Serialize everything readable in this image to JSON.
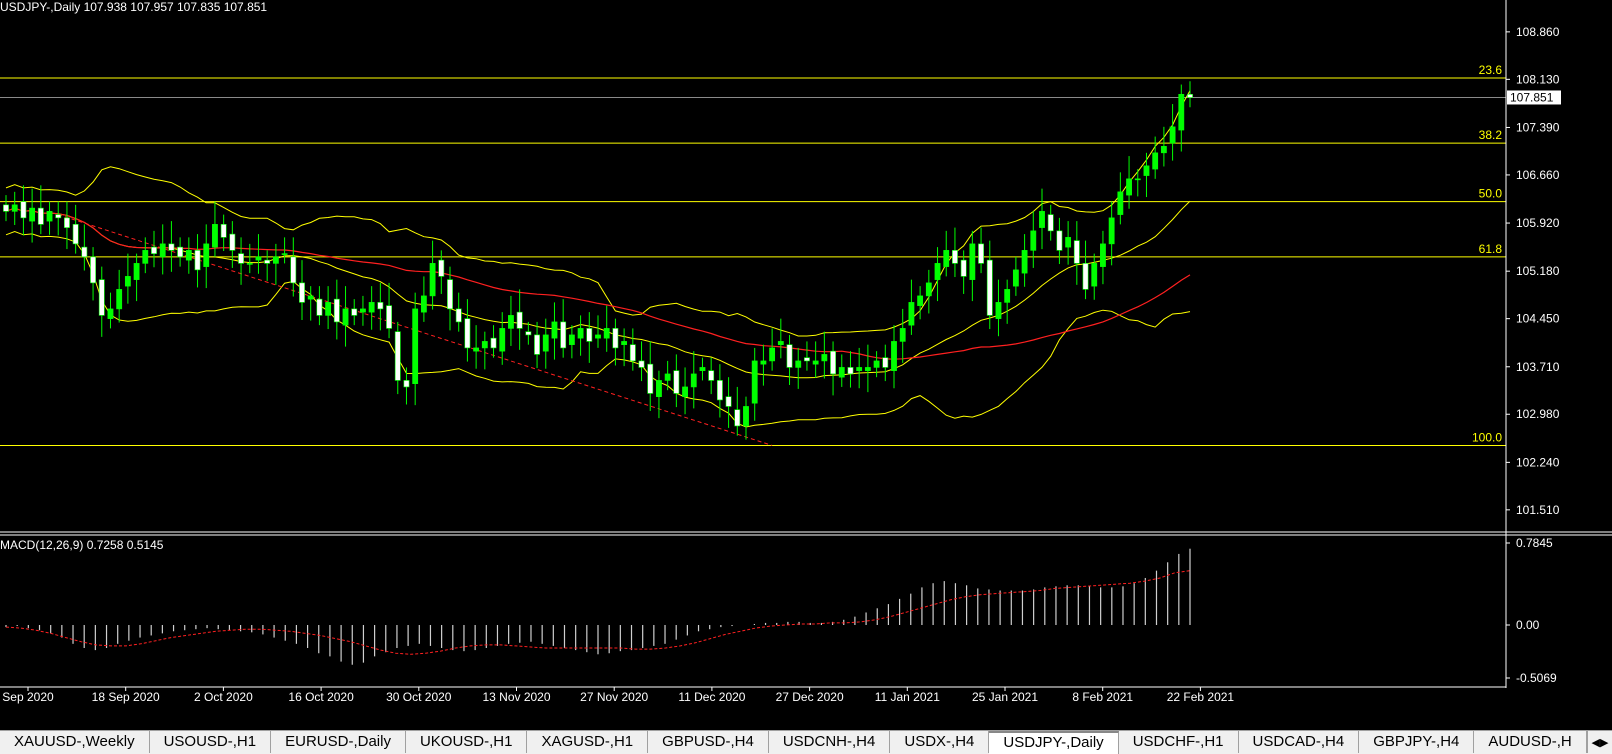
{
  "chart_data": [
    {
      "type": "candlestick",
      "title": "USDJPY-,Daily",
      "ohlc": "107.938 107.957 107.835 107.851",
      "last_price": "107.851",
      "price_ticks": [
        "108.860",
        "108.130",
        "107.390",
        "106.660",
        "105.920",
        "105.180",
        "104.450",
        "103.710",
        "102.980",
        "102.240",
        "101.510"
      ],
      "price_range": [
        101.2,
        109.35
      ],
      "date_ticks": [
        "Sep 2020",
        "18 Sep 2020",
        "2 Oct 2020",
        "16 Oct 2020",
        "30 Oct 2020",
        "13 Nov 2020",
        "27 Nov 2020",
        "11 Dec 2020",
        "27 Dec 2020",
        "11 Jan 2021",
        "25 Jan 2021",
        "8 Feb 2021",
        "22 Feb 2021"
      ],
      "fibonacci": [
        {
          "level": "23.6",
          "price": 108.15
        },
        {
          "level": "38.2",
          "price": 107.15
        },
        {
          "level": "50.0",
          "price": 106.25
        },
        {
          "level": "61.8",
          "price": 105.4
        },
        {
          "level": "100.0",
          "price": 102.5
        }
      ],
      "closes": [
        106.1,
        106.2,
        106.0,
        106.15,
        105.9,
        106.1,
        106.0,
        105.85,
        105.6,
        105.4,
        105.0,
        104.5,
        104.6,
        104.9,
        105.1,
        105.3,
        105.5,
        105.45,
        105.6,
        105.5,
        105.4,
        105.5,
        105.2,
        105.6,
        105.9,
        105.7,
        105.5,
        105.3,
        105.3,
        105.4,
        105.3,
        105.4,
        105.45,
        105.0,
        104.7,
        104.8,
        104.5,
        104.7,
        104.4,
        104.6,
        104.5,
        104.6,
        104.7,
        104.6,
        104.3,
        103.5,
        103.4,
        104.6,
        104.8,
        105.3,
        105.1,
        104.6,
        104.4,
        104.0,
        104.0,
        104.1,
        104.0,
        104.3,
        104.5,
        104.3,
        104.2,
        103.9,
        104.2,
        104.4,
        104.0,
        104.2,
        104.3,
        104.1,
        104.2,
        104.3,
        104.0,
        104.1,
        103.8,
        103.7,
        103.3,
        103.5,
        103.6,
        103.3,
        103.4,
        103.6,
        103.7,
        103.5,
        103.2,
        103.1,
        102.8,
        103.1,
        103.8,
        103.8,
        104.0,
        104.1,
        103.7,
        103.8,
        103.8,
        103.8,
        103.9,
        103.6,
        103.7,
        103.6,
        103.7,
        103.7,
        103.8,
        103.7,
        104.1,
        104.3,
        104.7,
        104.8,
        105.0,
        105.3,
        105.5,
        105.3,
        105.1,
        105.6,
        105.3,
        104.5,
        104.7,
        104.9,
        105.2,
        105.5,
        105.8,
        106.1,
        105.8,
        105.5,
        105.7,
        105.3,
        104.9,
        105.3,
        105.6,
        106.0,
        106.4,
        106.6,
        106.6,
        106.8,
        107.0,
        107.1,
        107.4,
        107.9,
        107.85
      ],
      "macd_label": "MACD(12,26,9) 0.7258 0.5145",
      "macd_ticks": [
        "0.7845",
        "0.00",
        "-0.5069"
      ],
      "macd_range": [
        -0.5069,
        0.7845
      ],
      "macd_hist": [
        -0.02,
        -0.01,
        -0.03,
        -0.05,
        -0.08,
        -0.12,
        -0.18,
        -0.22,
        -0.24,
        -0.22,
        -0.18,
        -0.15,
        -0.12,
        -0.1,
        -0.08,
        -0.06,
        -0.05,
        -0.04,
        -0.03,
        -0.04,
        -0.05,
        -0.06,
        -0.07,
        -0.09,
        -0.12,
        -0.15,
        -0.18,
        -0.22,
        -0.27,
        -0.3,
        -0.35,
        -0.38,
        -0.36,
        -0.3,
        -0.26,
        -0.22,
        -0.2,
        -0.18,
        -0.2,
        -0.22,
        -0.24,
        -0.25,
        -0.24,
        -0.22,
        -0.2,
        -0.18,
        -0.17,
        -0.16,
        -0.18,
        -0.2,
        -0.22,
        -0.24,
        -0.26,
        -0.28,
        -0.27,
        -0.25,
        -0.24,
        -0.22,
        -0.2,
        -0.18,
        -0.14,
        -0.1,
        -0.06,
        -0.04,
        -0.02,
        -0.01,
        0.0,
        0.01,
        0.02,
        0.02,
        0.03,
        0.03,
        0.02,
        0.02,
        0.03,
        0.05,
        0.08,
        0.12,
        0.16,
        0.2,
        0.25,
        0.3,
        0.36,
        0.4,
        0.42,
        0.4,
        0.38,
        0.35,
        0.34,
        0.33,
        0.33,
        0.33,
        0.34,
        0.36,
        0.37,
        0.38,
        0.38,
        0.37,
        0.36,
        0.36,
        0.37,
        0.4,
        0.45,
        0.52,
        0.6,
        0.68,
        0.73
      ],
      "macd_signal": [
        -0.02,
        -0.03,
        -0.05,
        -0.08,
        -0.12,
        -0.16,
        -0.19,
        -0.2,
        -0.2,
        -0.18,
        -0.15,
        -0.12,
        -0.1,
        -0.08,
        -0.06,
        -0.05,
        -0.04,
        -0.04,
        -0.05,
        -0.06,
        -0.08,
        -0.1,
        -0.13,
        -0.16,
        -0.2,
        -0.24,
        -0.27,
        -0.28,
        -0.27,
        -0.25,
        -0.22,
        -0.2,
        -0.19,
        -0.19,
        -0.2,
        -0.21,
        -0.22,
        -0.22,
        -0.22,
        -0.22,
        -0.22,
        -0.22,
        -0.23,
        -0.23,
        -0.22,
        -0.2,
        -0.17,
        -0.13,
        -0.09,
        -0.06,
        -0.03,
        -0.01,
        0.0,
        0.01,
        0.01,
        0.02,
        0.02,
        0.03,
        0.05,
        0.08,
        0.12,
        0.16,
        0.2,
        0.24,
        0.27,
        0.29,
        0.3,
        0.31,
        0.32,
        0.33,
        0.35,
        0.36,
        0.37,
        0.38,
        0.39,
        0.4,
        0.42,
        0.45,
        0.5,
        0.52
      ]
    }
  ],
  "tabs": [
    "XAUUSD-,Weekly",
    "USOUSD-,H1",
    "EURUSD-,Daily",
    "UKOUSD-,H1",
    "XAGUSD-,H1",
    "GBPUSD-,H4",
    "USDCNH-,H4",
    "USDX-,H4",
    "USDJPY-,Daily",
    "USDCHF-,H1",
    "USDCAD-,H4",
    "GBPJPY-,H4",
    "AUDUSD-,H"
  ],
  "active_tab": "USDJPY-,Daily",
  "colors": {
    "up": "#00ff00",
    "down": "#ffffff",
    "ma": "#ff2020",
    "bands": "#ffff00",
    "fib": "#ffff00",
    "grid": "#ffffff"
  }
}
